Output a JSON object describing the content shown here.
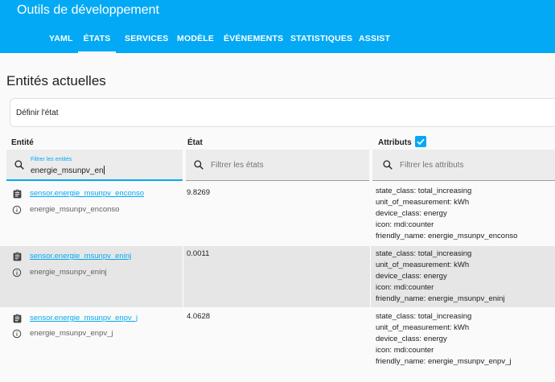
{
  "header": {
    "title": "Outils de développement",
    "tabs": [
      {
        "label": "YAML",
        "active": false
      },
      {
        "label": "ÉTATS",
        "active": true
      },
      {
        "label": "SERVICES",
        "active": false
      },
      {
        "label": "MODÈLE",
        "active": false
      },
      {
        "label": "ÉVÉNEMENTS",
        "active": false
      },
      {
        "label": "STATISTIQUES",
        "active": false
      },
      {
        "label": "ASSIST",
        "active": false
      }
    ]
  },
  "main": {
    "title": "Entités actuelles",
    "set_state_label": "Définir l'état",
    "columns": {
      "entity": "Entité",
      "state": "État",
      "attributes": "Attributs",
      "attributes_checked": true
    },
    "filters": {
      "entity_label": "Filtrer les entités",
      "entity_value": "energie_msunpv_en",
      "state_placeholder": "Filtrer les états",
      "attributes_placeholder": "Filtrer les attributs"
    },
    "rows": [
      {
        "entity_id": "sensor.energie_msunpv_enconso",
        "name": "energie_msunpv_enconso",
        "state": "9.8269",
        "attributes": [
          "state_class: total_increasing",
          "unit_of_measurement: kWh",
          "device_class: energy",
          "icon: mdi:counter",
          "friendly_name: energie_msunpv_enconso"
        ]
      },
      {
        "entity_id": "sensor.energie_msunpv_eninj",
        "name": "energie_msunpv_eninj",
        "state": "0.0011",
        "attributes": [
          "state_class: total_increasing",
          "unit_of_measurement: kWh",
          "device_class: energy",
          "icon: mdi:counter",
          "friendly_name: energie_msunpv_eninj"
        ]
      },
      {
        "entity_id": "sensor.energie_msunpv_enpv_j",
        "name": "energie_msunpv_enpv_j",
        "state": "4.0628",
        "attributes": [
          "state_class: total_increasing",
          "unit_of_measurement: kWh",
          "device_class: energy",
          "icon: mdi:counter",
          "friendly_name: energie_msunpv_enpv_j"
        ]
      }
    ]
  },
  "colors": {
    "primary": "#03a9f4",
    "row_alt": "#e6e6e6",
    "filter_bg": "#ececec"
  },
  "icons": {
    "search": "search-icon",
    "entity": "clipboard-icon",
    "info": "info-icon",
    "check": "check-icon"
  }
}
